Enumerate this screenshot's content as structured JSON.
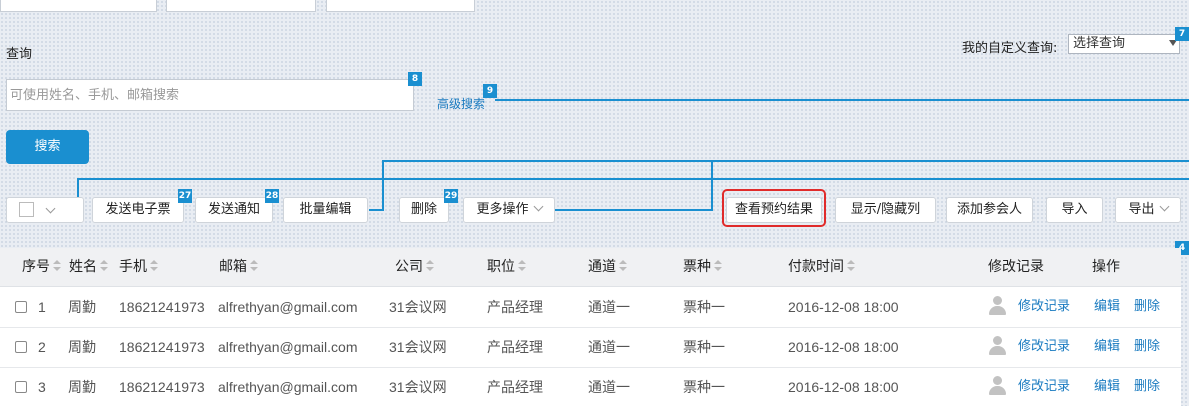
{
  "query_label": "查询",
  "custom_query": {
    "label": "我的自定义查询:",
    "selected": "选择查询"
  },
  "search": {
    "placeholder": "可使用姓名、手机、邮箱搜索",
    "advanced_label": "高级搜索",
    "button_label": "搜索"
  },
  "badges": {
    "b7": "7",
    "b8": "8",
    "b9": "9",
    "b27": "27",
    "b28": "28",
    "b29": "29",
    "b4": "4"
  },
  "toolbar": {
    "send_ticket": "发送电子票",
    "send_notice": "发送通知",
    "batch_edit": "批量编辑",
    "delete": "删除",
    "more_actions": "更多操作",
    "view_booking": "查看预约结果",
    "toggle_columns": "显示/隐藏列",
    "add_attendee": "添加参会人",
    "import": "导入",
    "export": "导出"
  },
  "table": {
    "headers": {
      "index": "序号",
      "name": "姓名",
      "phone": "手机",
      "email": "邮箱",
      "company": "公司",
      "position": "职位",
      "channel": "通道",
      "ticket": "票种",
      "pay_time": "付款时间",
      "edit_log": "修改记录",
      "actions": "操作"
    },
    "rows": [
      {
        "index": "1",
        "name": "周勤",
        "phone": "18621241973",
        "email": "alfrethyan@gmail.com",
        "company": "31会议网",
        "position": "产品经理",
        "channel": "通道一",
        "ticket": "票种一",
        "pay_time": "2016-12-08 18:00",
        "edit_log": "修改记录",
        "edit": "编辑",
        "delete": "删除"
      },
      {
        "index": "2",
        "name": "周勤",
        "phone": "18621241973",
        "email": "alfrethyan@gmail.com",
        "company": "31会议网",
        "position": "产品经理",
        "channel": "通道一",
        "ticket": "票种一",
        "pay_time": "2016-12-08 18:00",
        "edit_log": "修改记录",
        "edit": "编辑",
        "delete": "删除"
      },
      {
        "index": "3",
        "name": "周勤",
        "phone": "18621241973",
        "email": "alfrethyan@gmail.com",
        "company": "31会议网",
        "position": "产品经理",
        "channel": "通道一",
        "ticket": "票种一",
        "pay_time": "2016-12-08 18:00",
        "edit_log": "修改记录",
        "edit": "编辑",
        "delete": "删除"
      }
    ]
  },
  "colors": {
    "accent": "#1a8fd0",
    "highlight": "#e02b2b",
    "link": "#1a7bc0"
  },
  "icons": {
    "avatar": "user-avatar-icon",
    "dropdown": "chevron-down-icon",
    "sort": "sort-icon"
  }
}
